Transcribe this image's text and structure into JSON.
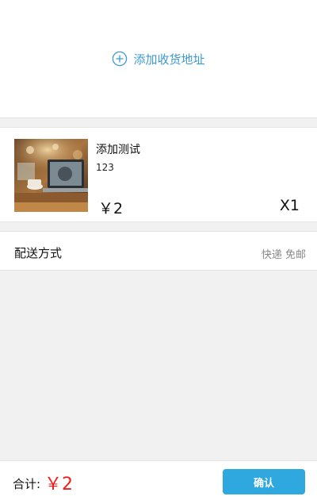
{
  "address": {
    "add_label": "添加收货地址",
    "icon": "plus-circle-icon",
    "accent_color": "#3b9ad3"
  },
  "product": {
    "name": "添加测试",
    "description": "123",
    "price": "￥2",
    "quantity": "X1"
  },
  "shipping": {
    "label": "配送方式",
    "value": "快递 免邮"
  },
  "footer": {
    "total_label": "合计:",
    "total_value": "￥2",
    "total_color": "#f41b1b",
    "confirm_label": "确认",
    "confirm_color": "#2fa8e0"
  }
}
